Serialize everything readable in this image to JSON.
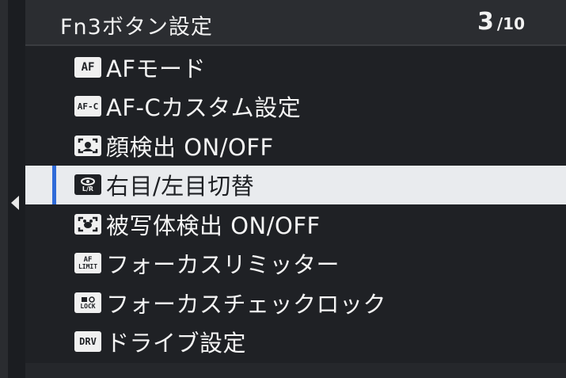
{
  "header": {
    "title": "Fn3ボタン設定",
    "page_current": "3",
    "page_total": "/10"
  },
  "menu": {
    "items": [
      {
        "icon": "AF",
        "label": "AFモード"
      },
      {
        "icon": "AF-C",
        "label": "AF-Cカスタム設定"
      },
      {
        "icon": "face-detect",
        "label": "顔検出 ON/OFF"
      },
      {
        "icon": "eye-L/R",
        "label": "右目/左目切替"
      },
      {
        "icon": "subject-detect",
        "label": "被写体検出 ON/OFF"
      },
      {
        "icon": "AF LIMIT",
        "label": "フォーカスリミッター"
      },
      {
        "icon": "LOCK",
        "label": "フォーカスチェックロック"
      },
      {
        "icon": "DRV",
        "label": "ドライブ設定"
      }
    ],
    "selected_index": 3
  },
  "colors": {
    "background": "#1f2125",
    "selection": "#e9ebee",
    "selection_marker": "#2f6bd8"
  }
}
